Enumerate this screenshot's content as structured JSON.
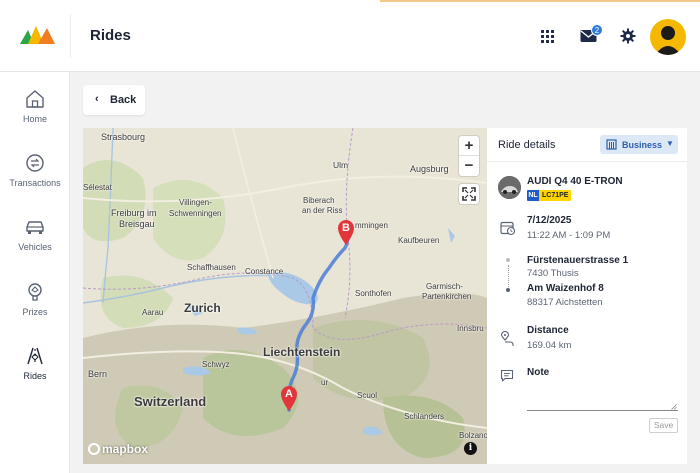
{
  "header": {
    "title": "Rides",
    "mail_badge_count": "2",
    "accent_color": "#f5b800"
  },
  "sidebar": {
    "items": [
      {
        "label": "Home",
        "icon": "home-icon"
      },
      {
        "label": "Transactions",
        "icon": "transactions-icon"
      },
      {
        "label": "Vehicles",
        "icon": "car-icon"
      },
      {
        "label": "Prizes",
        "icon": "trophy-icon"
      },
      {
        "label": "Rides",
        "icon": "rides-icon",
        "active": true
      }
    ]
  },
  "back_button": {
    "label": "Back"
  },
  "map": {
    "attribution": "mapbox",
    "zoom_in": "+",
    "zoom_out": "−",
    "info": "i",
    "labels": {
      "strasbourg": "Strasbourg",
      "ulm": "Ulm",
      "augsburg": "Augsburg",
      "selestat": "Sélestat",
      "villingen": "Villingen-",
      "schwenningen": "Schwenningen",
      "biberach": "Biberach",
      "an_der_riss": "an der Riss",
      "memmingen": "mmingen",
      "freiburg": "Freiburg im",
      "breisgau": "Breisgau",
      "kaufbeuren": "Kaufbeuren",
      "schaffhausen": "Schaffhausen",
      "constance": "Constance",
      "sonthofen": "Sonthofen",
      "garmisch": "Garmisch-",
      "partenkirchen": "Partenkirchen",
      "aarau": "Aarau",
      "zurich": "Zurich",
      "liechtenstein": "Liechtenstein",
      "innsbruck": "Innsbru",
      "schwyz": "Schwyz",
      "bern": "Bern",
      "chur": "ur",
      "switzerland": "Switzerland",
      "scuol": "Scuol",
      "schladers": "Schlanders",
      "bolzano": "Bolzano",
      "marker_a": "A",
      "marker_b": "B"
    }
  },
  "ride_details": {
    "title": "Ride details",
    "category": "Business",
    "vehicle": {
      "model": "AUDI Q4 40 E-TRON",
      "plate_country": "NL",
      "plate_number": "LC71PE"
    },
    "date": "7/12/2025",
    "time_range": "11:22 AM - 1:09 PM",
    "origin": {
      "street": "Fürstenauerstrasse 1",
      "city": "7430 Thusis"
    },
    "destination": {
      "street": "Am Waizenhof 8",
      "city": "88317 Aichstetten"
    },
    "distance_label": "Distance",
    "distance_value": "169.04 km",
    "note_label": "Note",
    "note_value": "",
    "save_label": "Save"
  }
}
